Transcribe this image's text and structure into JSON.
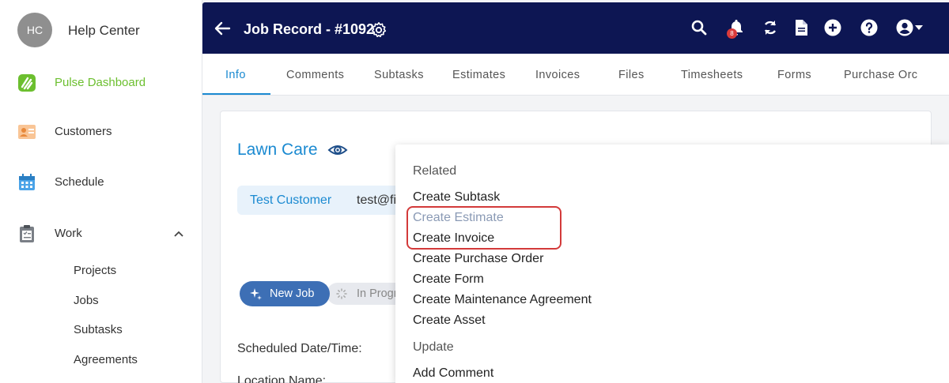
{
  "sidebar": {
    "avatar_initials": "HC",
    "title": "Help Center",
    "items": [
      {
        "label": "Pulse Dashboard",
        "icon": "pulse-logo-icon"
      },
      {
        "label": "Customers",
        "icon": "contact-card-icon"
      },
      {
        "label": "Schedule",
        "icon": "calendar-icon"
      },
      {
        "label": "Work",
        "icon": "clipboard-icon"
      }
    ],
    "work_subitems": [
      "Projects",
      "Jobs",
      "Subtasks",
      "Agreements"
    ]
  },
  "topbar": {
    "title": "Job Record - #1092",
    "notification_count": "8"
  },
  "tabs": [
    "Info",
    "Comments",
    "Subtasks",
    "Estimates",
    "Invoices",
    "Files",
    "Timesheets",
    "Forms",
    "Purchase Orc"
  ],
  "job": {
    "name": "Lawn Care",
    "customer_name": "Test Customer",
    "customer_email": "test@fi",
    "status_new": "New Job",
    "status_next": "In Progr",
    "scheduled_label": "Scheduled Date/Time:",
    "location_label": "Location Name:"
  },
  "menu": {
    "related_heading": "Related",
    "related_items": [
      "Create Subtask",
      "Create Estimate",
      "Create Invoice",
      "Create Purchase Order",
      "Create Form",
      "Create Maintenance Agreement",
      "Create Asset"
    ],
    "update_heading": "Update",
    "update_items": [
      "Add Comment"
    ]
  },
  "colors": {
    "topbar_bg": "#0d1653",
    "accent_blue": "#1b8ad1",
    "pulse_green": "#6cbf2f",
    "highlight_red": "#d33a3a"
  }
}
